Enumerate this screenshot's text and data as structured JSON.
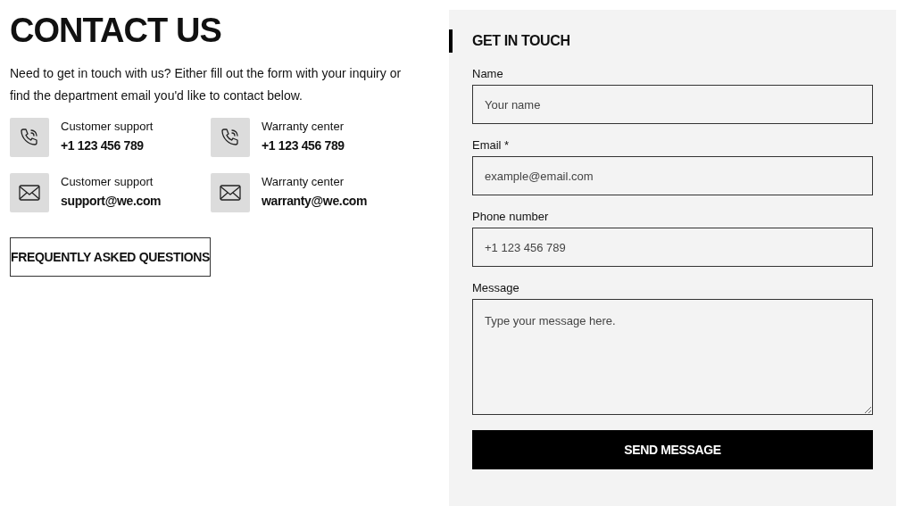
{
  "title": "CONTACT US",
  "intro": "Need to get in touch with us? Either fill out the form with your inquiry or find the department email you'd like to contact below.",
  "contacts": [
    {
      "kind": "phone",
      "label": "Customer support",
      "value": "+1 123 456 789"
    },
    {
      "kind": "phone",
      "label": "Warranty center",
      "value": "+1 123 456 789"
    },
    {
      "kind": "email",
      "label": "Customer support",
      "value": "support@we.com"
    },
    {
      "kind": "email",
      "label": "Warranty center",
      "value": "warranty@we.com"
    }
  ],
  "faq_button": "FREQUENTLY ASKED QUESTIONS",
  "form": {
    "heading": "GET IN TOUCH",
    "fields": [
      {
        "kind": "input",
        "label": "Name",
        "placeholder": "Your name"
      },
      {
        "kind": "input",
        "label": "Email *",
        "placeholder": "example@email.com"
      },
      {
        "kind": "input",
        "label": "Phone number",
        "placeholder": "+1 123 456 789"
      },
      {
        "kind": "textarea",
        "label": "Message",
        "placeholder": "Type your message here."
      }
    ],
    "submit": "SEND MESSAGE"
  }
}
